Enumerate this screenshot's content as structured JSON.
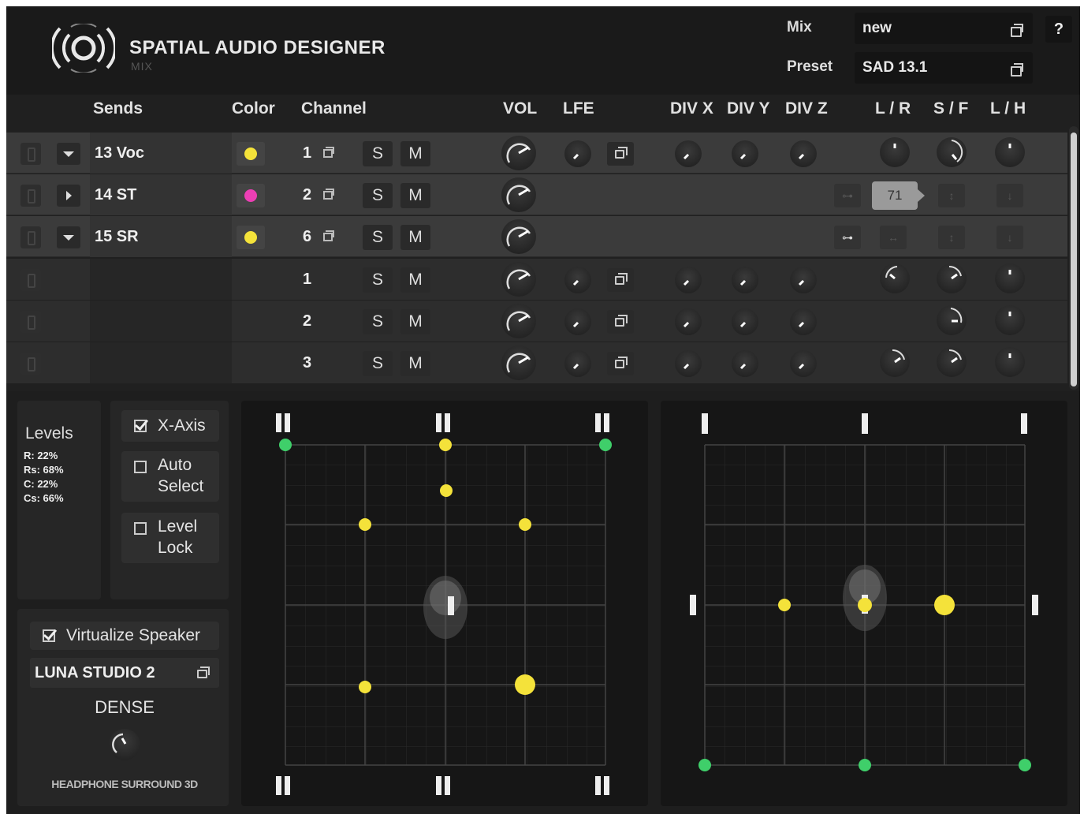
{
  "app": {
    "title": "SPATIAL AUDIO DESIGNER",
    "subtitle": "MIX",
    "mix_label": "Mix",
    "mix_value": "new",
    "preset_label": "Preset",
    "preset_value": "SAD 13.1",
    "help_label": "?"
  },
  "columns": {
    "sends": "Sends",
    "color": "Color",
    "channel": "Channel",
    "vol": "VOL",
    "lfe": "LFE",
    "div_x": "DIV X",
    "div_y": "DIV Y",
    "div_z": "DIV Z",
    "lr": "L / R",
    "sf": "S / F",
    "lh": "L / H"
  },
  "rows": [
    {
      "name": "13 Voc",
      "color": "#f4e23a",
      "channel": "1",
      "solo": "S",
      "mute": "M",
      "expanded": true
    },
    {
      "name": "14 ST",
      "color": "#ec3fb4",
      "channel": "2",
      "solo": "S",
      "mute": "M",
      "expanded": false
    },
    {
      "name": "15 SR",
      "color": "#f4e23a",
      "channel": "6",
      "solo": "S",
      "mute": "M",
      "expanded": true
    },
    {
      "name": "",
      "channel": "1",
      "solo": "S",
      "mute": "M"
    },
    {
      "name": "",
      "channel": "2",
      "solo": "S",
      "mute": "M"
    },
    {
      "name": "",
      "channel": "3",
      "solo": "S",
      "mute": "M"
    }
  ],
  "tooltip_value": "71",
  "levels": {
    "title": "Levels",
    "lines": [
      "R: 22%",
      "Rs: 68%",
      "C: 22%",
      "Cs: 66%"
    ]
  },
  "options": {
    "x_axis": "X-Axis",
    "auto_select": "Auto Select",
    "level_lock": "Level Lock",
    "x_axis_checked": true,
    "auto_select_checked": false,
    "level_lock_checked": false
  },
  "virtualize": {
    "label": "Virtualize Speaker",
    "checked": true,
    "speaker": "LUNA STUDIO 2",
    "mode": "DENSE",
    "footer": "HEADPHONE SURROUND 3D"
  },
  "colors": {
    "yellow": "#f4e23a",
    "green": "#3fcf6a",
    "magenta": "#ec3fb4"
  }
}
